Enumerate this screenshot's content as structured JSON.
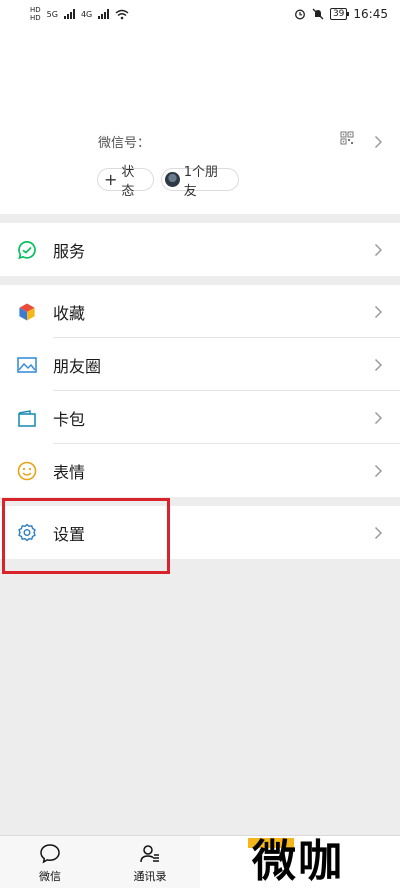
{
  "status_bar": {
    "hd1": "HD",
    "hd2": "HD",
    "net_5g": "5G",
    "net_4g": "4G",
    "battery": "39",
    "time": "16:45"
  },
  "profile": {
    "wechat_id_label": "微信号：",
    "status_pill": "状态",
    "friends_pill": "1个朋友"
  },
  "menu": {
    "services": "服务",
    "favorites": "收藏",
    "moments": "朋友圈",
    "cards": "卡包",
    "stickers": "表情",
    "settings": "设置"
  },
  "tab_bar": {
    "chats": "微信",
    "contacts": "通讯录"
  },
  "watermark": "微咖",
  "colors": {
    "wechat_green": "#07c160",
    "highlight_red": "#d9232a",
    "watermark_yellow": "#f5b619"
  }
}
